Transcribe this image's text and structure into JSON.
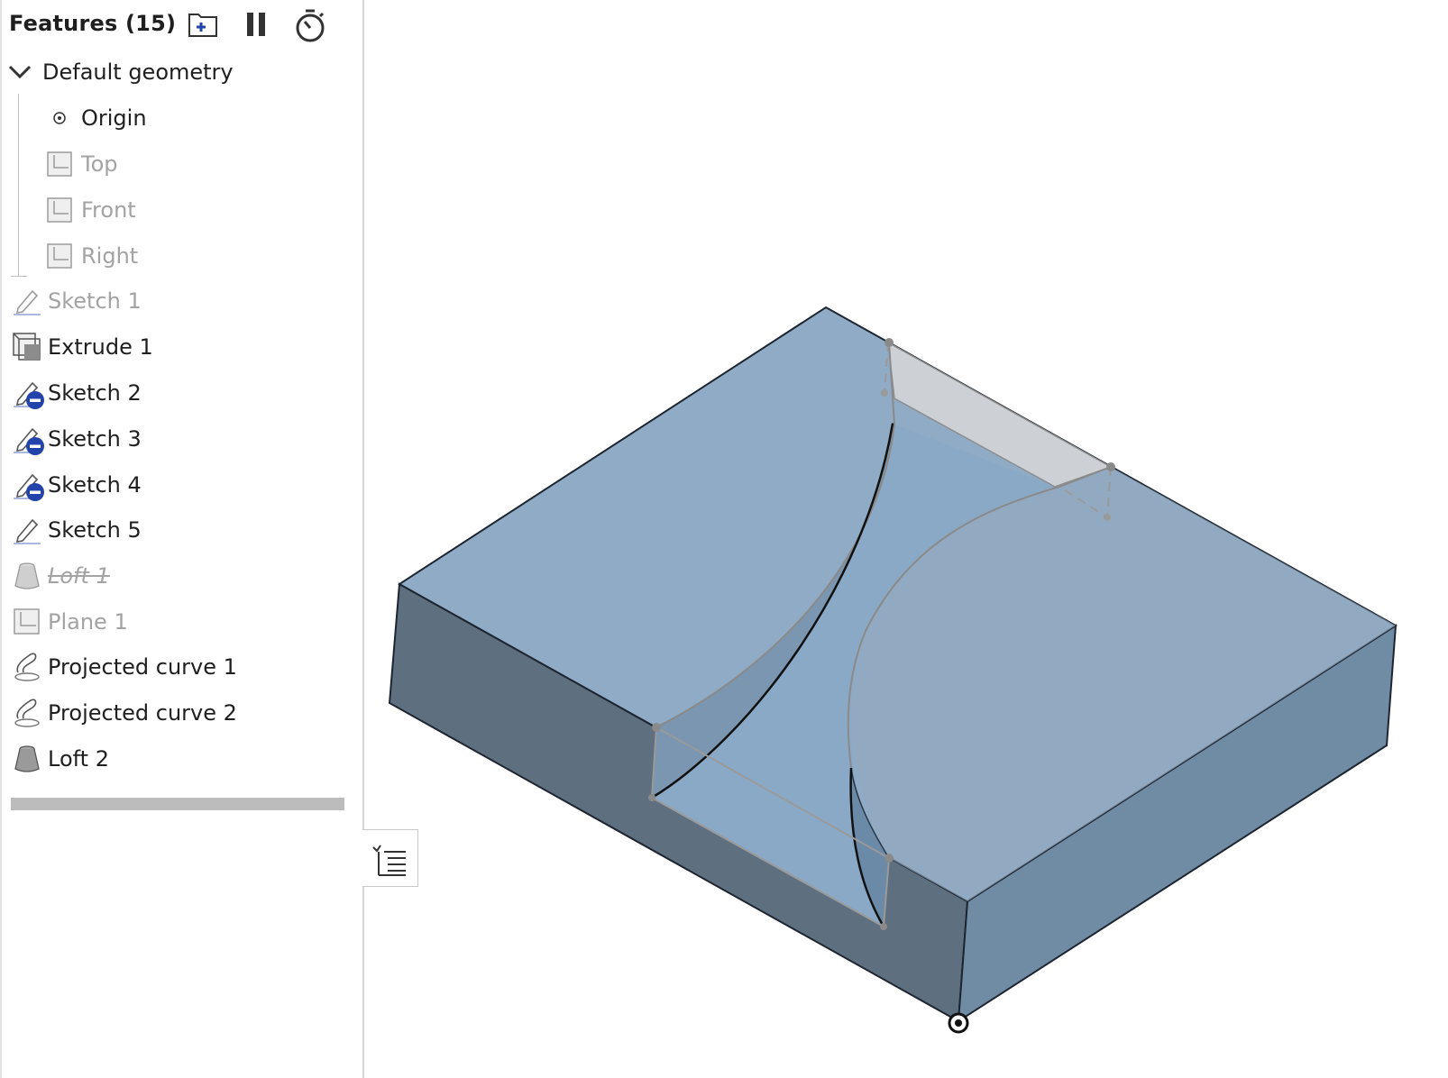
{
  "panel": {
    "title": "Features (15)",
    "header_buttons": [
      "add-folder-icon",
      "pause-icon",
      "stopwatch-icon"
    ]
  },
  "tree": {
    "group_label": "Default geometry",
    "group_expanded": true,
    "children": [
      {
        "label": "Origin",
        "icon": "origin-icon",
        "muted": false
      },
      {
        "label": "Top",
        "icon": "plane-icon",
        "muted": true
      },
      {
        "label": "Front",
        "icon": "plane-icon",
        "muted": true
      },
      {
        "label": "Right",
        "icon": "plane-icon",
        "muted": true
      }
    ]
  },
  "features": [
    {
      "label": "Sketch 1",
      "icon": "sketch-icon",
      "state": "hidden"
    },
    {
      "label": "Extrude 1",
      "icon": "extrude-icon",
      "state": "normal"
    },
    {
      "label": "Sketch 2",
      "icon": "sketch-icon",
      "state": "hidden-badge"
    },
    {
      "label": "Sketch 3",
      "icon": "sketch-icon",
      "state": "hidden-badge"
    },
    {
      "label": "Sketch 4",
      "icon": "sketch-icon",
      "state": "hidden-badge"
    },
    {
      "label": "Sketch 5",
      "icon": "sketch-icon",
      "state": "normal"
    },
    {
      "label": "Loft 1",
      "icon": "loft-icon",
      "state": "suppressed"
    },
    {
      "label": "Plane 1",
      "icon": "plane-icon",
      "state": "hidden"
    },
    {
      "label": "Projected curve 1",
      "icon": "projected-curve-icon",
      "state": "normal"
    },
    {
      "label": "Projected curve 2",
      "icon": "projected-curve-icon",
      "state": "normal"
    },
    {
      "label": "Loft 2",
      "icon": "loft-icon",
      "state": "normal"
    }
  ],
  "colors": {
    "top_face": "#8fabc5",
    "left_face": "#5e6f80",
    "right_face": "#708ca5",
    "badge": "#2244aa",
    "muted_text": "#a3a3a3"
  }
}
